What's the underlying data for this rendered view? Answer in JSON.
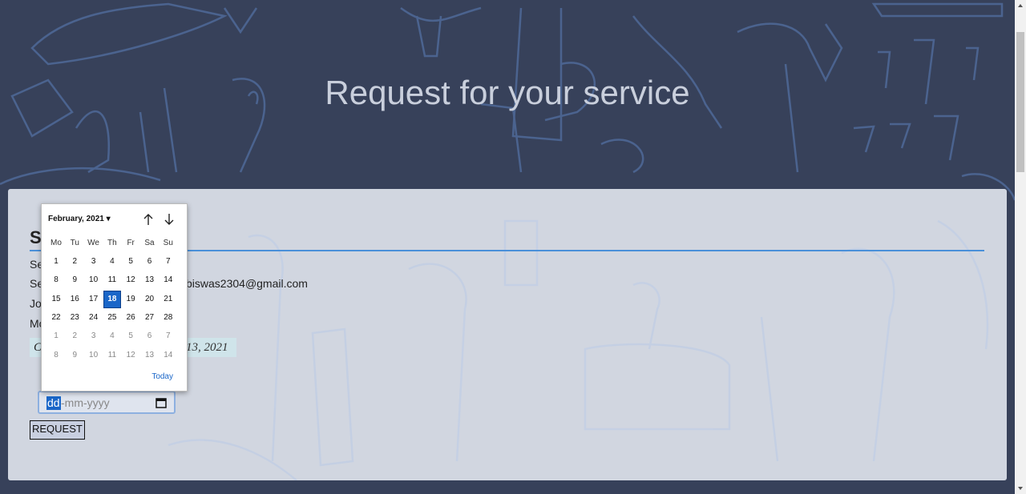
{
  "page": {
    "title": "Request for your service"
  },
  "card": {
    "heading": "S",
    "rows": [
      {
        "text": "Se"
      },
      {
        "text": "Se"
      },
      {
        "text": "Jo"
      },
      {
        "text": "Mo"
      }
    ],
    "email": "biswas2304@gmail.com",
    "date_prefix": "C",
    "date_suffix": "13, 2021"
  },
  "date_input": {
    "day_placeholder": "dd",
    "rest_placeholder": "-mm-yyyy"
  },
  "request_button": {
    "label": "REQUEST"
  },
  "calendar": {
    "month_label": "February, 2021",
    "weekdays": [
      "Mo",
      "Tu",
      "We",
      "Th",
      "Fr",
      "Sa",
      "Su"
    ],
    "weeks": [
      [
        "1",
        "2",
        "3",
        "4",
        "5",
        "6",
        "7"
      ],
      [
        "8",
        "9",
        "10",
        "11",
        "12",
        "13",
        "14"
      ],
      [
        "15",
        "16",
        "17",
        "18",
        "19",
        "20",
        "21"
      ],
      [
        "22",
        "23",
        "24",
        "25",
        "26",
        "27",
        "28"
      ],
      [
        "1",
        "2",
        "3",
        "4",
        "5",
        "6",
        "7"
      ],
      [
        "8",
        "9",
        "10",
        "11",
        "12",
        "13",
        "14"
      ]
    ],
    "selected_day": "18",
    "today_label": "Today"
  },
  "colors": {
    "background": "#37415a",
    "accent": "#1a66c8",
    "rule": "#4a90d9"
  }
}
